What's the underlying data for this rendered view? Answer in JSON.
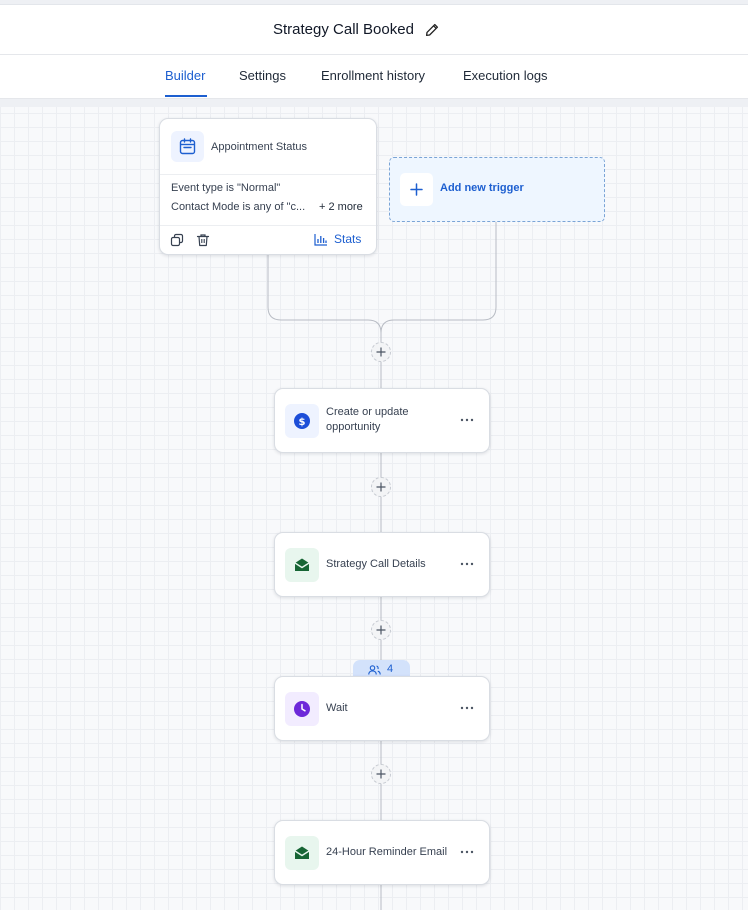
{
  "header": {
    "title": "Strategy Call Booked"
  },
  "tabs": [
    {
      "label": "Builder",
      "active": true
    },
    {
      "label": "Settings",
      "active": false
    },
    {
      "label": "Enrollment history",
      "active": false
    },
    {
      "label": "Execution logs",
      "active": false
    }
  ],
  "trigger": {
    "name": "Appointment Status",
    "filters": [
      "Event type is \"Normal\"",
      "Contact Mode is any of \"c..."
    ],
    "more": "+ 2 more",
    "stats_label": "Stats"
  },
  "add_trigger": {
    "label": "Add new trigger"
  },
  "actions": [
    {
      "label": "Create or update opportunity",
      "icon": "dollar-icon",
      "icon_color": "#1d4ed8",
      "icon_bg": "#eef3ff"
    },
    {
      "label": "Strategy Call Details",
      "icon": "email-icon",
      "icon_color": "#166534",
      "icon_bg": "#e8f6ee"
    },
    {
      "label": "Wait",
      "icon": "clock-icon",
      "icon_color": "#6d28d9",
      "icon_bg": "#f2ecff"
    },
    {
      "label": "24-Hour Reminder Email",
      "icon": "email-icon",
      "icon_color": "#166534",
      "icon_bg": "#e8f6ee"
    }
  ],
  "wait_badge": {
    "count": "4"
  },
  "colors": {
    "accent": "#1d5fd0",
    "connector": "#b8bcc4"
  }
}
